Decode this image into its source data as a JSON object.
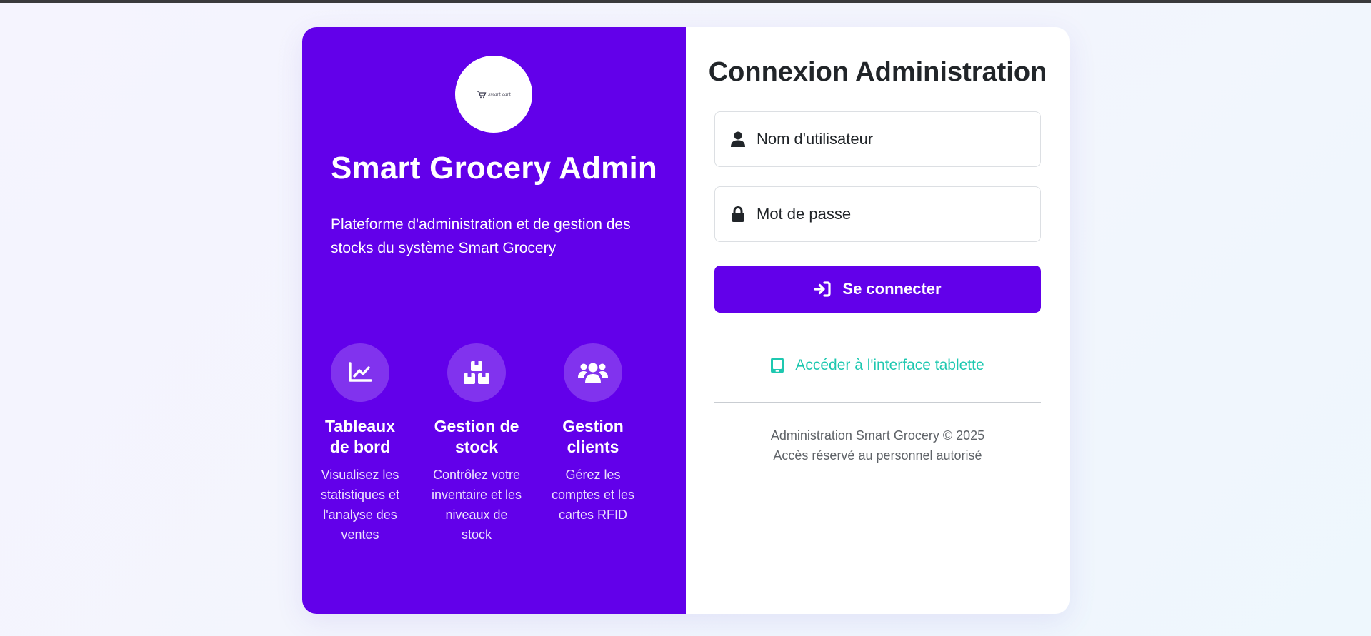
{
  "brand": {
    "logo_text": "smart cart",
    "title": "Smart Grocery Admin",
    "description": "Plateforme d'administration et de gestion des stocks du système Smart Grocery"
  },
  "features": [
    {
      "icon": "chart-line-icon",
      "title": "Tableaux de bord",
      "description": "Visualisez les statistiques et l'analyse des ventes"
    },
    {
      "icon": "boxes-icon",
      "title": "Gestion de stock",
      "description": "Contrôlez votre inventaire et les niveaux de stock"
    },
    {
      "icon": "users-icon",
      "title": "Gestion clients",
      "description": "Gérez les comptes et les cartes RFID"
    }
  ],
  "login": {
    "title": "Connexion Administration",
    "username_placeholder": "Nom d'utilisateur",
    "username_value": "",
    "password_placeholder": "Mot de passe",
    "password_value": "",
    "submit_label": "Se connecter",
    "tablet_link_label": "Accéder à l'interface tablette"
  },
  "footer": {
    "line1": "Administration Smart Grocery © 2025",
    "line2": "Accès réservé au personnel autorisé"
  },
  "colors": {
    "primary": "#6200ea",
    "accent_link": "#1ec8b0",
    "text_dark": "#212529",
    "text_muted": "#5f6368"
  }
}
